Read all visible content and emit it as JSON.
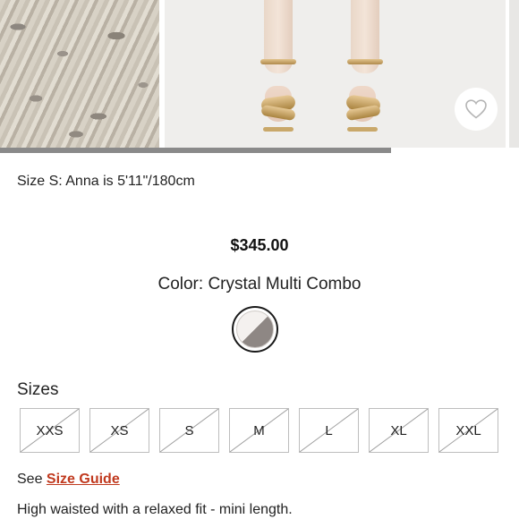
{
  "gallery": {
    "progress_fraction": 0.753
  },
  "product": {
    "model_info": "Size S: Anna is 5'11\"/180cm",
    "price": "$345.00",
    "color_label": "Color:",
    "color_name": "Crystal Multi Combo",
    "swatch_colors": [
      "#f4f1ef",
      "#8e8784"
    ],
    "accent_color": "#c0391e"
  },
  "sizes": {
    "label": "Sizes",
    "options": [
      "XXS",
      "XS",
      "S",
      "M",
      "L",
      "XL",
      "XXL"
    ],
    "all_unavailable": true
  },
  "size_guide": {
    "prefix": "See",
    "link_text": "Size Guide"
  },
  "description": "High waisted with a relaxed fit - mini length.",
  "icons": {
    "wishlist": "heart-icon"
  }
}
